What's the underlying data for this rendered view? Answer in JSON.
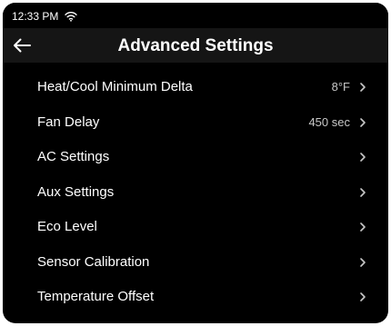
{
  "status_bar": {
    "time": "12:33 PM",
    "wifi_icon": "wifi-icon"
  },
  "header": {
    "back_icon": "arrow-left-icon",
    "title": "Advanced Settings"
  },
  "settings": [
    {
      "label": "Heat/Cool Minimum Delta",
      "value": "8°F"
    },
    {
      "label": "Fan Delay",
      "value": "450 sec"
    },
    {
      "label": "AC Settings",
      "value": ""
    },
    {
      "label": "Aux Settings",
      "value": ""
    },
    {
      "label": "Eco Level",
      "value": ""
    },
    {
      "label": "Sensor Calibration",
      "value": ""
    },
    {
      "label": "Temperature Offset",
      "value": ""
    }
  ],
  "colors": {
    "background": "#000000",
    "header_background": "#151515",
    "text": "#ffffff",
    "value_text": "#c8c8c8"
  }
}
